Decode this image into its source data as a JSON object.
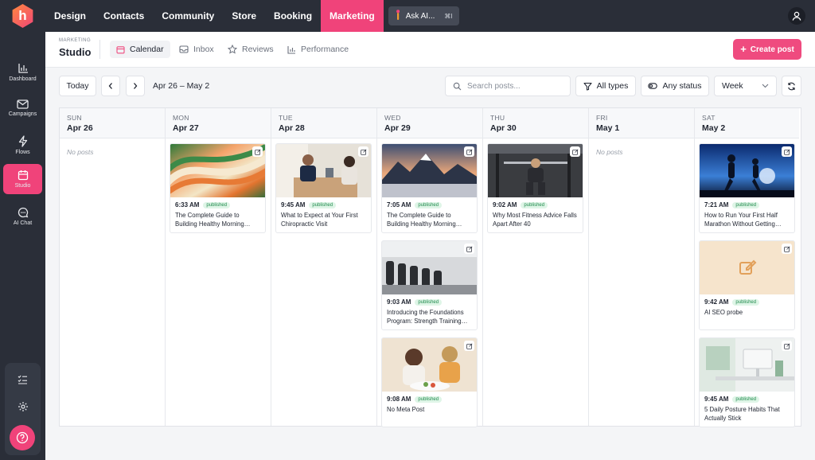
{
  "topnav": {
    "logo_letter": "h",
    "tabs": [
      "Design",
      "Contacts",
      "Community",
      "Store",
      "Booking",
      "Marketing"
    ],
    "active_tab": "Marketing",
    "ask_ai": "Ask AI...",
    "ask_ai_shortcut": "⌘I"
  },
  "sidebar": {
    "items": [
      {
        "label": "Dashboard",
        "icon": "bar-chart-icon"
      },
      {
        "label": "Campaigns",
        "icon": "mail-icon"
      },
      {
        "label": "Flows",
        "icon": "bolt-icon"
      },
      {
        "label": "Studio",
        "icon": "calendar-icon"
      },
      {
        "label": "AI Chat",
        "icon": "chat-icon"
      }
    ],
    "active_item": "Studio"
  },
  "header": {
    "section": "MARKETING",
    "title": "Studio",
    "tabs": [
      {
        "label": "Calendar",
        "icon": "calendar-icon"
      },
      {
        "label": "Inbox",
        "icon": "inbox-icon"
      },
      {
        "label": "Reviews",
        "icon": "star-icon"
      },
      {
        "label": "Performance",
        "icon": "bar-chart-icon"
      }
    ],
    "active_tab": "Calendar",
    "create_button": "Create post"
  },
  "toolbar": {
    "today": "Today",
    "range": "Apr 26 – May 2",
    "search_placeholder": "Search posts...",
    "type_filter": "All types",
    "status_filter": "Any status",
    "view": "Week"
  },
  "days": [
    {
      "dow": "SUN",
      "date": "Apr 26",
      "empty_text": "No posts",
      "posts": []
    },
    {
      "dow": "MON",
      "date": "Apr 27",
      "posts": [
        {
          "time": "6:33 AM",
          "status": "published",
          "title": "The Complete Guide to Building Healthy Morning…",
          "image": "abstract-waves"
        }
      ]
    },
    {
      "dow": "TUE",
      "date": "Apr 28",
      "posts": [
        {
          "time": "9:45 AM",
          "status": "published",
          "title": "What to Expect at Your First Chiropractic Visit",
          "image": "clinic-consult"
        }
      ]
    },
    {
      "dow": "WED",
      "date": "Apr 29",
      "posts": [
        {
          "time": "7:05 AM",
          "status": "published",
          "title": "The Complete Guide to Building Healthy Morning…",
          "image": "mountains"
        },
        {
          "time": "9:03 AM",
          "status": "published",
          "title": "Introducing the Foundations Program: Strength Training…",
          "image": "dumbbells"
        },
        {
          "time": "9:08 AM",
          "status": "published",
          "title": "No Meta Post",
          "image": "friends-eating"
        }
      ]
    },
    {
      "dow": "THU",
      "date": "Apr 30",
      "posts": [
        {
          "time": "9:02 AM",
          "status": "published",
          "title": "Why Most Fitness Advice Falls Apart After 40",
          "image": "gym-squat"
        }
      ]
    },
    {
      "dow": "FRI",
      "date": "May 1",
      "empty_text": "No posts",
      "posts": []
    },
    {
      "dow": "SAT",
      "date": "May 2",
      "posts": [
        {
          "time": "7:21 AM",
          "status": "published",
          "title": "How to Run Your First Half Marathon Without Getting…",
          "image": "runners"
        },
        {
          "time": "9:42 AM",
          "status": "published",
          "title": "AI SEO probe",
          "image": "placeholder-edit"
        },
        {
          "time": "9:45 AM",
          "status": "published",
          "title": "5 Daily Posture Habits That Actually Stick",
          "image": "office-desk"
        }
      ]
    }
  ],
  "colors": {
    "accent": "#ef4b7f",
    "nav_bg": "#2a2e38",
    "published_bg": "#dff5e7",
    "published_fg": "#1f8a4c"
  }
}
